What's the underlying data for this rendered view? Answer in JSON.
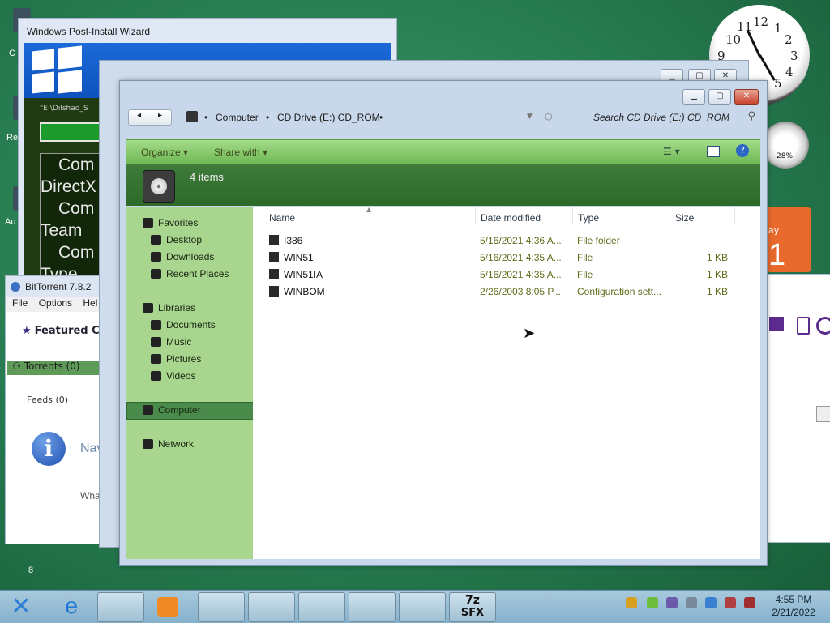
{
  "desktop": {
    "left_labels": [
      "C",
      "Re",
      "Au"
    ],
    "bottom_number": "8"
  },
  "wizard": {
    "title": "Windows Post-Install Wizard",
    "path_text": "\"E:\\Dilshad_S",
    "list_items": [
      "Com",
      "DirectX",
      "Com",
      "Team",
      "Com",
      "Type"
    ]
  },
  "bittorrent": {
    "title": "BitTorrent 7.8.2",
    "menu": [
      "File",
      "Options",
      "Hel"
    ],
    "featured": "Featured Co",
    "torrents": "Torrents (0)",
    "feeds": "Feeds (0)",
    "nav_text": "Nav",
    "what_text": "Wha"
  },
  "explorer": {
    "breadcrumb": [
      "Computer",
      "CD Drive (E:) CD_ROM"
    ],
    "search_placeholder": "Search CD Drive (E:) CD_ROM",
    "toolbar": {
      "organize": "Organize",
      "share_with": "Share with"
    },
    "item_count": "4 items",
    "nav": {
      "favorites": "Favorites",
      "favorites_items": [
        "Desktop",
        "Downloads",
        "Recent Places"
      ],
      "libraries": "Libraries",
      "libraries_items": [
        "Documents",
        "Music",
        "Pictures",
        "Videos"
      ],
      "computer": "Computer",
      "network": "Network"
    },
    "columns": {
      "name": "Name",
      "date": "Date modified",
      "type": "Type",
      "size": "Size"
    },
    "files": [
      {
        "name": "I386",
        "date": "5/16/2021 4:36 A...",
        "type": "File folder",
        "size": ""
      },
      {
        "name": "WIN51",
        "date": "5/16/2021 4:35 A...",
        "type": "File",
        "size": "1 KB"
      },
      {
        "name": "WIN51IA",
        "date": "5/16/2021 4:35 A...",
        "type": "File",
        "size": "1 KB"
      },
      {
        "name": "WINBOM",
        "date": "2/26/2003 8:05 P...",
        "type": "Configuration sett...",
        "size": "1 KB"
      }
    ]
  },
  "gadgets": {
    "clock_numbers": [
      "12",
      "1",
      "2",
      "3",
      "4",
      "5",
      "9",
      "10",
      "11"
    ],
    "meter_value": "28%",
    "calendar_text": "ay",
    "calendar_day": "1"
  },
  "taskbar": {
    "time": "4:55 PM",
    "date": "2/21/2022",
    "sfx_top": "7z",
    "sfx_bottom": "SFX"
  }
}
